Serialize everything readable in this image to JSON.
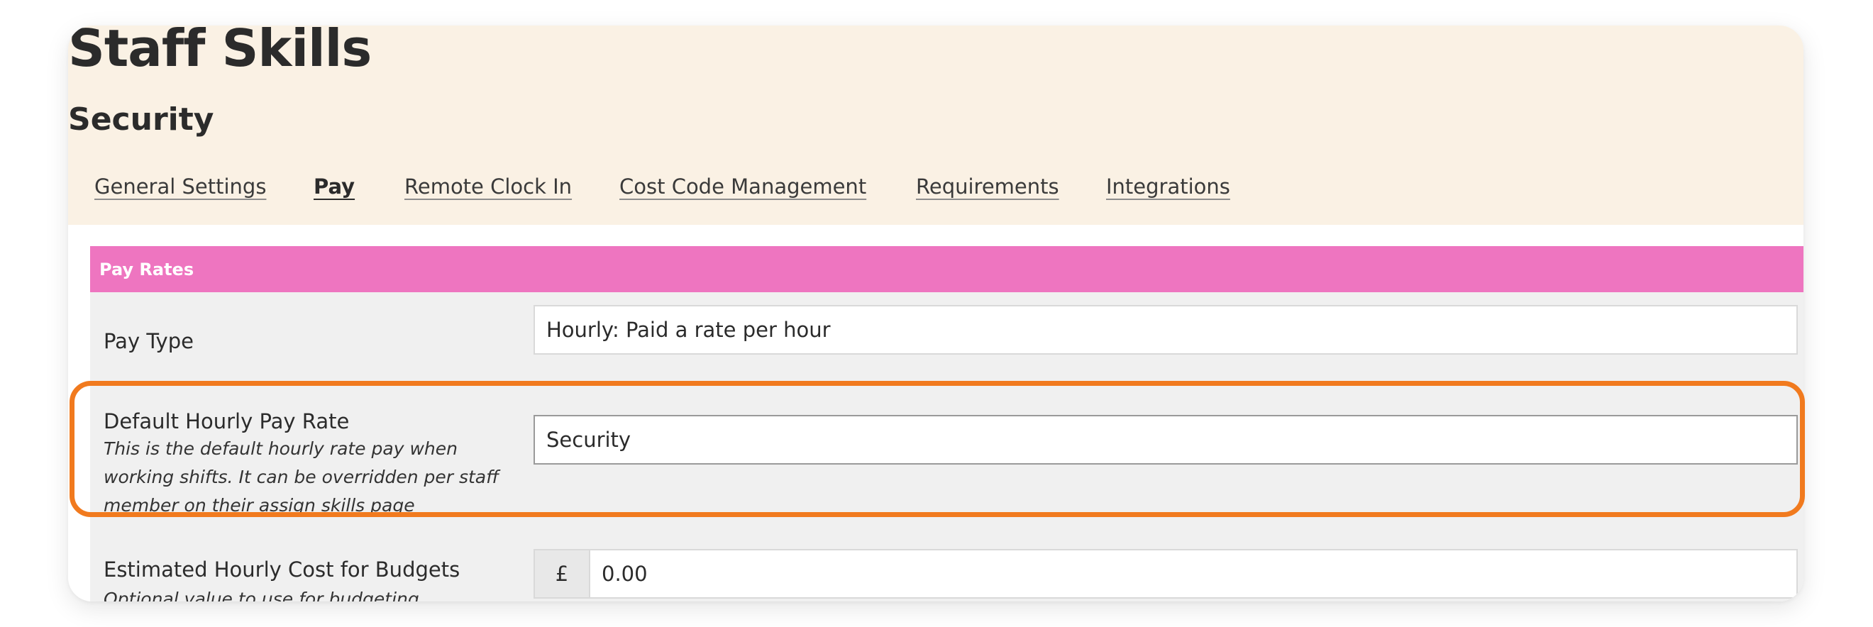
{
  "page": {
    "title": "Staff Skills",
    "subtitle": "Security"
  },
  "tabs": [
    {
      "label": "General Settings",
      "active": false
    },
    {
      "label": "Pay",
      "active": true
    },
    {
      "label": "Remote Clock In",
      "active": false
    },
    {
      "label": "Cost Code Management",
      "active": false
    },
    {
      "label": "Requirements",
      "active": false
    },
    {
      "label": "Integrations",
      "active": false
    }
  ],
  "section": {
    "title": "Pay Rates",
    "color": "#ee75c0"
  },
  "fields": {
    "pay_type": {
      "label": "Pay Type",
      "value": "Hourly: Paid a rate per hour"
    },
    "default_rate": {
      "label": "Default Hourly Pay Rate",
      "help": "This is the default hourly rate pay when working shifts. It can be overridden per staff member on their assign skills page",
      "value": "Security"
    },
    "estimated_cost": {
      "label": "Estimated Hourly Cost for Budgets",
      "help": "Optional value to use for budgeting",
      "currency": "£",
      "value": "0.00"
    }
  },
  "colors": {
    "header_bg": "#faf1e4",
    "highlight": "#f17a1e"
  }
}
